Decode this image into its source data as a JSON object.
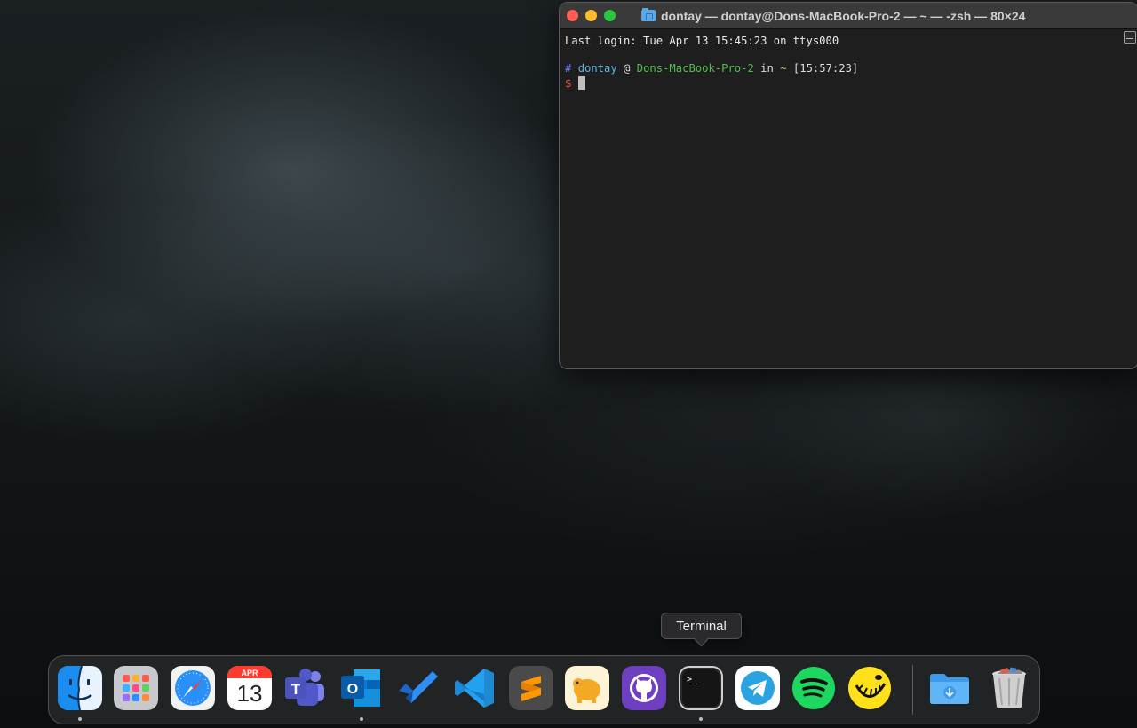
{
  "terminal": {
    "title": "dontay — dontay@Dons-MacBook-Pro-2 — ~ — -zsh — 80×24",
    "last_login": "Last login: Tue Apr 13 15:45:23 on ttys000",
    "prompt": {
      "hash": "#",
      "user": "dontay",
      "at": "@",
      "host": "Dons-MacBook-Pro-2",
      "in": "in",
      "dir": "~",
      "time": "[15:57:23]",
      "dollar": "$"
    }
  },
  "tooltip": {
    "text": "Terminal"
  },
  "dock": {
    "calendar": {
      "month": "APR",
      "day": "13"
    },
    "apps": [
      {
        "name": "Finder",
        "icon": "finder-icon",
        "running": true
      },
      {
        "name": "Launchpad",
        "icon": "launchpad-icon",
        "running": false
      },
      {
        "name": "Safari",
        "icon": "safari-icon",
        "running": false
      },
      {
        "name": "Calendar",
        "icon": "calendar-icon",
        "running": false
      },
      {
        "name": "Microsoft Teams",
        "icon": "teams-icon",
        "running": false
      },
      {
        "name": "Microsoft Outlook",
        "icon": "outlook-icon",
        "running": true
      },
      {
        "name": "Microsoft To Do",
        "icon": "todo-icon",
        "running": false
      },
      {
        "name": "Visual Studio Code",
        "icon": "vscode-icon",
        "running": false
      },
      {
        "name": "Sublime Text",
        "icon": "sublime-icon",
        "running": false
      },
      {
        "name": "TablePlus",
        "icon": "tableplus-icon",
        "running": false
      },
      {
        "name": "GitHub Desktop",
        "icon": "github-icon",
        "running": false
      },
      {
        "name": "Terminal",
        "icon": "terminal-icon",
        "running": true
      },
      {
        "name": "Telegram",
        "icon": "telegram-icon",
        "running": false
      },
      {
        "name": "Spotify",
        "icon": "spotify-icon",
        "running": false
      },
      {
        "name": "Postman",
        "icon": "postman-icon",
        "running": false
      },
      {
        "name": "Downloads",
        "icon": "downloads-folder-icon",
        "running": false
      },
      {
        "name": "Trash",
        "icon": "trash-icon",
        "running": false
      }
    ]
  },
  "colors": {
    "close": "#ff5f57",
    "minimize": "#febc2e",
    "maximize": "#28c840",
    "terminal_bg": "#1e1e1e"
  }
}
